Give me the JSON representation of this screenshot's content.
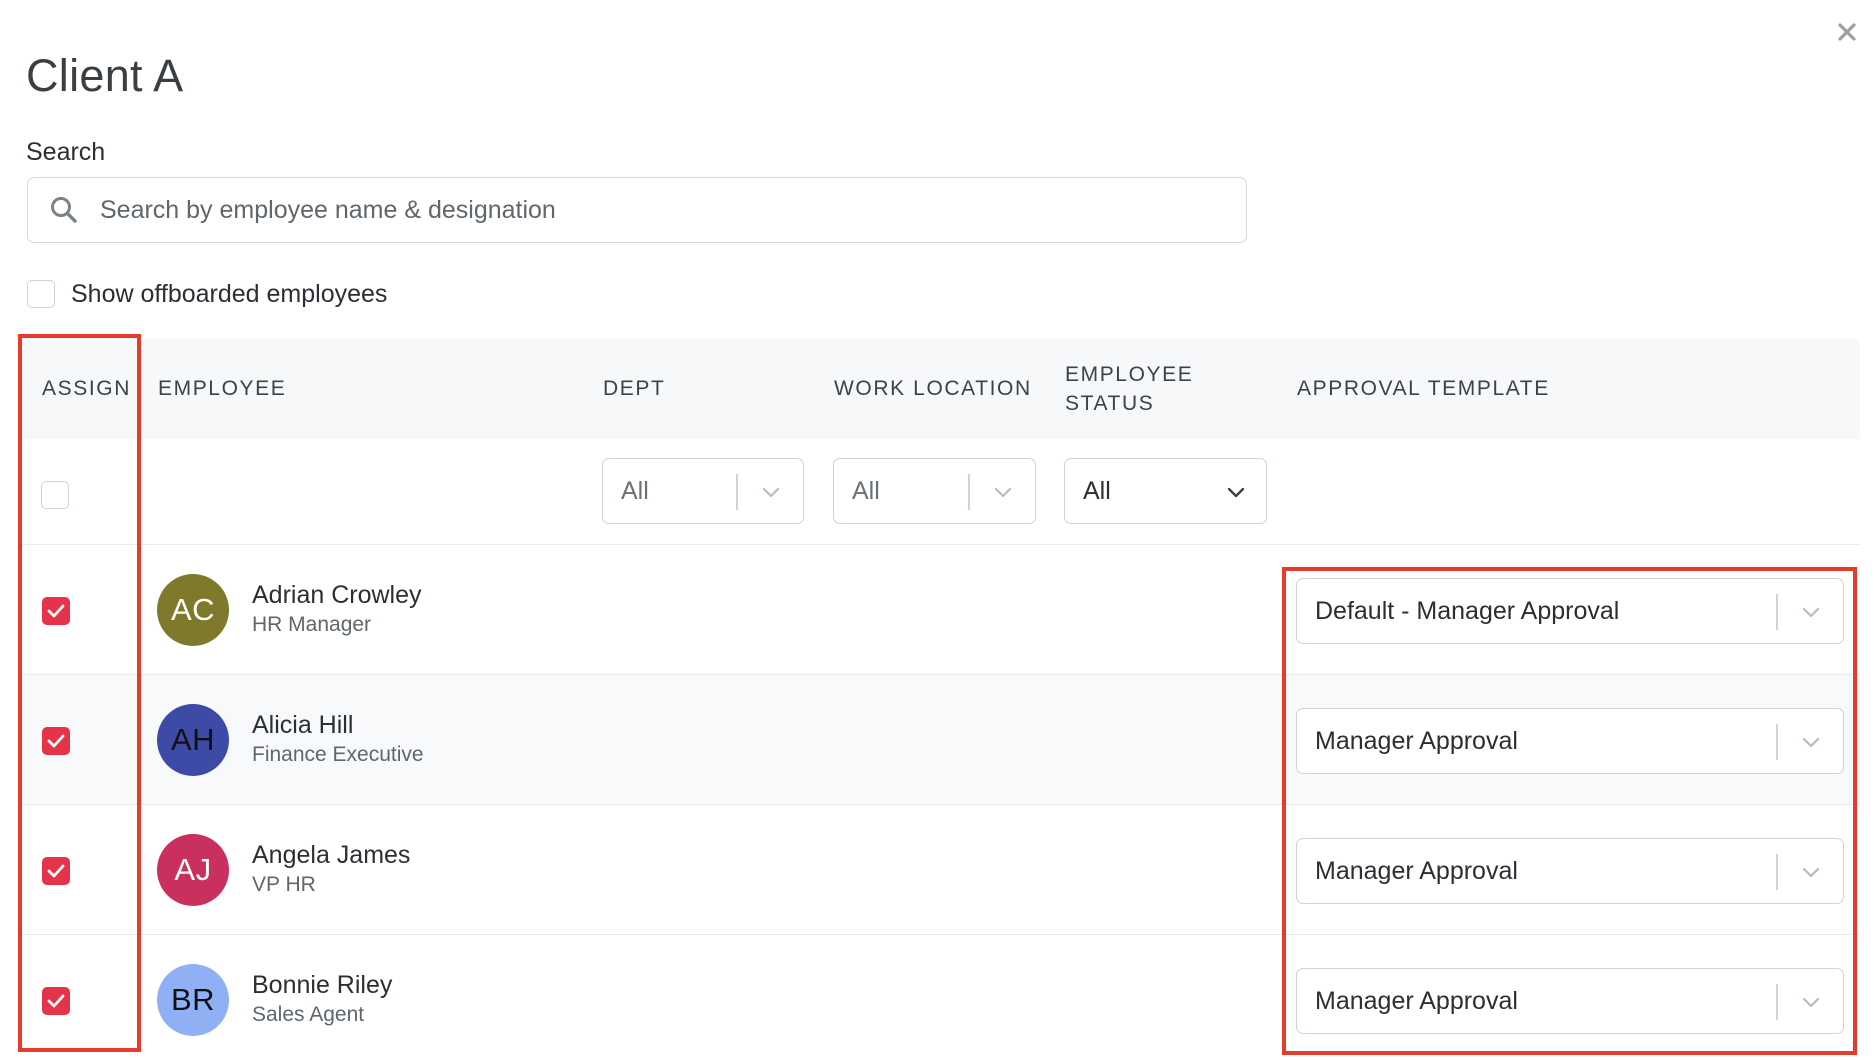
{
  "dialog": {
    "title": "Client A",
    "close_icon": "close-icon"
  },
  "search": {
    "label": "Search",
    "placeholder": "Search by employee name & designation",
    "value": "",
    "icon": "search-icon"
  },
  "offboarded": {
    "label": "Show offboarded employees",
    "checked": false
  },
  "table": {
    "headers": {
      "assign": "ASSIGN",
      "employee": "EMPLOYEE",
      "dept": "DEPT",
      "work_location": "WORK LOCATION",
      "employee_status_line1": "EMPLOYEE",
      "employee_status_line2": "STATUS",
      "approval_template": "APPROVAL TEMPLATE"
    },
    "filters": {
      "select_all_checked": false,
      "dept": "All",
      "work_location": "All",
      "employee_status": "All"
    },
    "rows": [
      {
        "checked": true,
        "initials": "AC",
        "avatar_color": "#7f7a2b",
        "initials_color": "#ffffff",
        "name": "Adrian Crowley",
        "designation": "HR Manager",
        "approval_template": "Default - Manager Approval"
      },
      {
        "checked": true,
        "initials": "AH",
        "avatar_color": "#3d4aa6",
        "initials_color": "#111111",
        "name": "Alicia Hill",
        "designation": "Finance Executive",
        "approval_template": "Manager Approval"
      },
      {
        "checked": true,
        "initials": "AJ",
        "avatar_color": "#c9305d",
        "initials_color": "#ffffff",
        "name": "Angela James",
        "designation": "VP HR",
        "approval_template": "Manager Approval"
      },
      {
        "checked": true,
        "initials": "BR",
        "avatar_color": "#8fb0f5",
        "initials_color": "#111111",
        "name": "Bonnie Riley",
        "designation": "Sales Agent",
        "approval_template": "Manager Approval"
      }
    ]
  },
  "colors": {
    "checkbox_checked": "#e5344a",
    "annotation_box": "#e53b2c"
  }
}
